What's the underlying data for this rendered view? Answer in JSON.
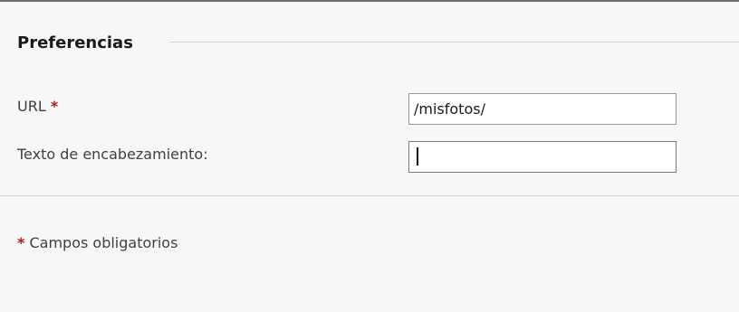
{
  "section": {
    "title": "Preferencias"
  },
  "fields": {
    "url": {
      "label": "URL",
      "required_mark": "*",
      "value": "/misfotos/"
    },
    "header_text": {
      "label": "Texto de encabezamiento:",
      "value": ""
    }
  },
  "footnote": {
    "mark": "*",
    "text": "Campos obligatorios"
  },
  "colors": {
    "required": "#b31b1b",
    "background": "#f7f7f7"
  }
}
